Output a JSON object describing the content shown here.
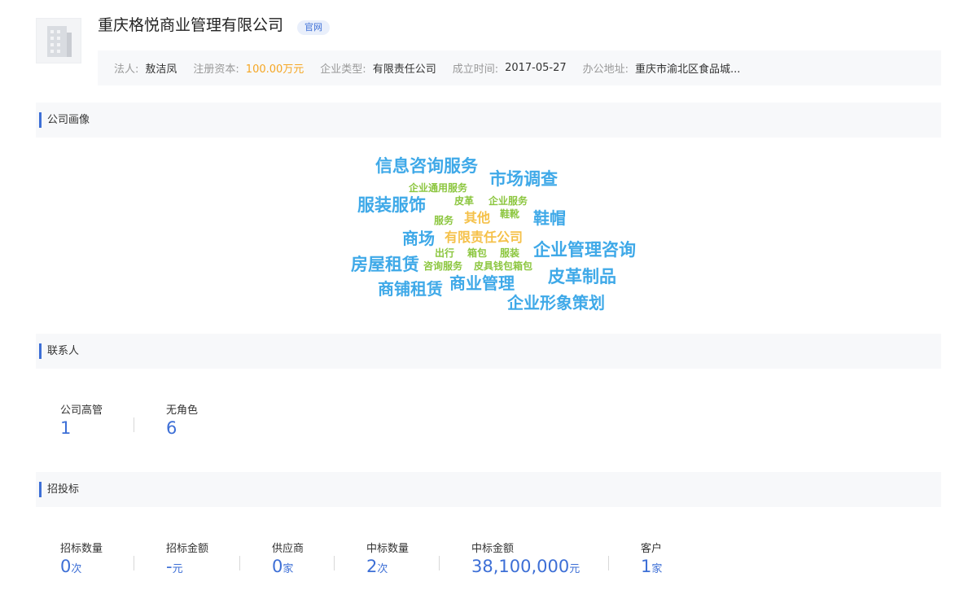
{
  "company": {
    "name": "重庆格悦商业管理有限公司",
    "badge": "官网",
    "logo_icon": "building-icon"
  },
  "info": [
    {
      "label": "法人:",
      "value": "敖洁凤",
      "highlight": false
    },
    {
      "label": "注册资本:",
      "value": "100.00万元",
      "highlight": true
    },
    {
      "label": "企业类型:",
      "value": "有限责任公司",
      "highlight": false
    },
    {
      "label": "成立时间:",
      "value": "2017-05-27",
      "highlight": false
    },
    {
      "label": "办公地址:",
      "value": "重庆市渝北区食品城...",
      "highlight": false
    }
  ],
  "sections": {
    "portrait": "公司画像",
    "contacts": "联系人",
    "bidding": "招投标"
  },
  "colors": {
    "accent": "#3d6fd6",
    "orange": "#f5a623",
    "cloud_blue": "#3fa9e8",
    "cloud_green": "#8cc63f",
    "cloud_yellow": "#f5c14a"
  },
  "wordcloud": [
    {
      "text": "信息咨询服务",
      "color": "blue"
    },
    {
      "text": "市场调查",
      "color": "blue"
    },
    {
      "text": "企业通用服务",
      "color": "green"
    },
    {
      "text": "服装服饰",
      "color": "blue"
    },
    {
      "text": "皮革",
      "color": "green"
    },
    {
      "text": "企业服务",
      "color": "green"
    },
    {
      "text": "服务",
      "color": "green"
    },
    {
      "text": "其他",
      "color": "yellow"
    },
    {
      "text": "鞋靴",
      "color": "green"
    },
    {
      "text": "鞋帽",
      "color": "blue"
    },
    {
      "text": "商场",
      "color": "blue"
    },
    {
      "text": "有限责任公司",
      "color": "yellow"
    },
    {
      "text": "出行",
      "color": "green"
    },
    {
      "text": "箱包",
      "color": "green"
    },
    {
      "text": "服装",
      "color": "green"
    },
    {
      "text": "企业管理咨询",
      "color": "blue"
    },
    {
      "text": "房屋租赁",
      "color": "blue"
    },
    {
      "text": "咨询服务",
      "color": "green"
    },
    {
      "text": "皮具钱包箱包",
      "color": "green"
    },
    {
      "text": "皮革制品",
      "color": "blue"
    },
    {
      "text": "商铺租赁",
      "color": "blue"
    },
    {
      "text": "商业管理",
      "color": "blue"
    },
    {
      "text": "企业形象策划",
      "color": "blue"
    }
  ],
  "contacts": [
    {
      "label": "公司高管",
      "value": "1",
      "unit": ""
    },
    {
      "label": "无角色",
      "value": "6",
      "unit": ""
    }
  ],
  "bidding": [
    {
      "label": "招标数量",
      "value": "0",
      "unit": "次"
    },
    {
      "label": "招标金额",
      "value": "-",
      "unit": "元"
    },
    {
      "label": "供应商",
      "value": "0",
      "unit": "家"
    },
    {
      "label": "中标数量",
      "value": "2",
      "unit": "次"
    },
    {
      "label": "中标金额",
      "value": "38,100,000",
      "unit": "元"
    },
    {
      "label": "客户",
      "value": "1",
      "unit": "家"
    }
  ]
}
